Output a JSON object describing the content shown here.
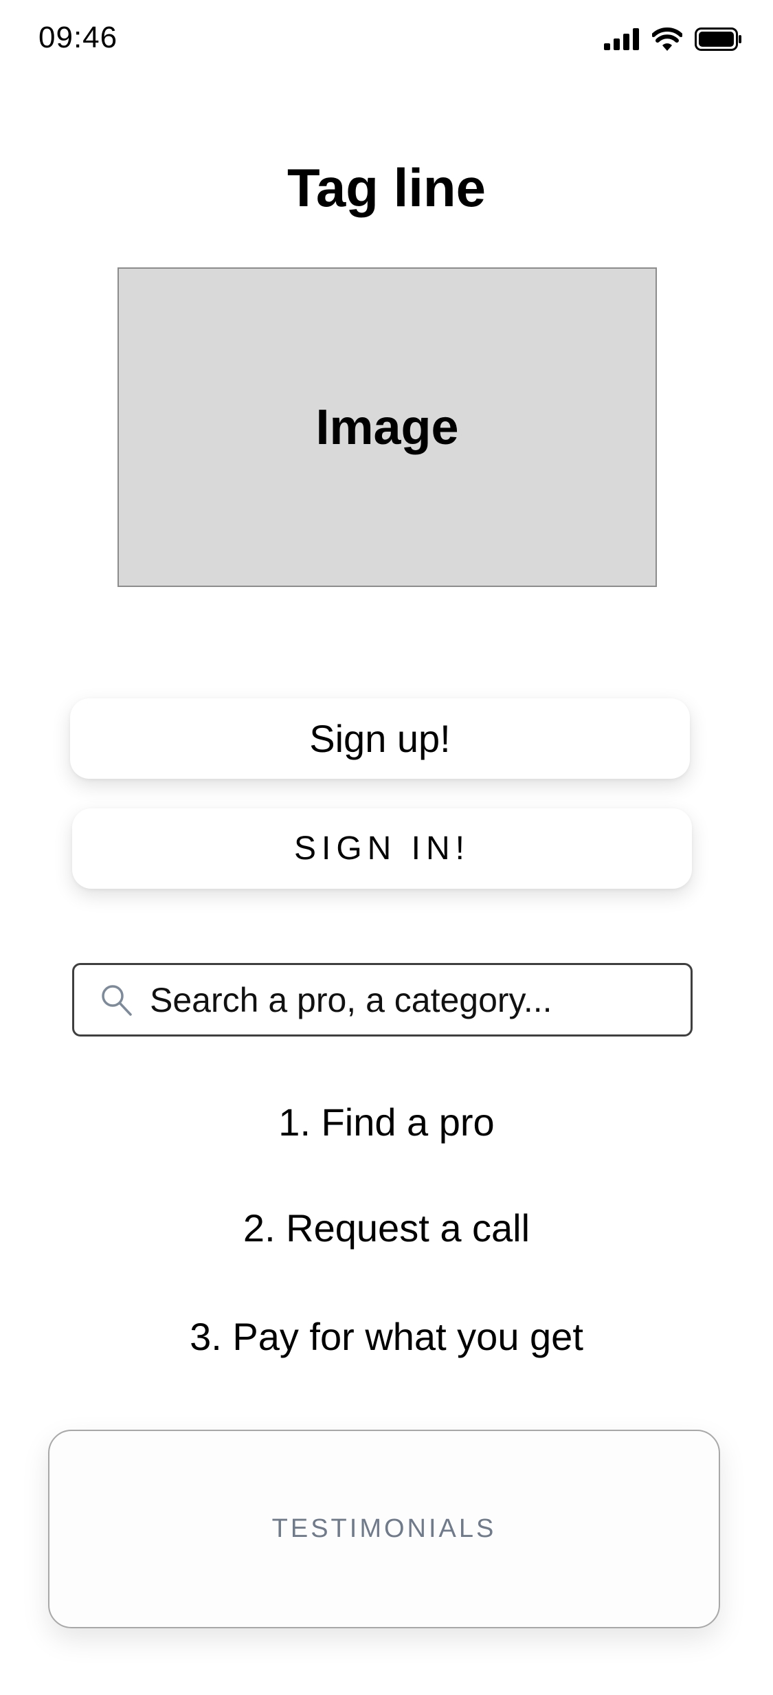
{
  "status_bar": {
    "time": "09:46"
  },
  "hero": {
    "tagline": "Tag line",
    "image_placeholder": "Image"
  },
  "actions": {
    "signup_label": "Sign up!",
    "signin_label": "SIGN IN!"
  },
  "search": {
    "placeholder": "Search a pro, a category..."
  },
  "steps": [
    {
      "label": "1. Find a pro"
    },
    {
      "label": "2. Request a call"
    },
    {
      "label": "3. Pay for what you get"
    }
  ],
  "testimonials": {
    "label": "TESTIMONIALS"
  },
  "icons": {
    "search": "search-icon",
    "signal": "cellular-signal-icon",
    "wifi": "wifi-icon",
    "battery": "battery-icon"
  },
  "colors": {
    "image_placeholder_bg": "#d9d9d9",
    "testimonials_text": "#6f7a8a"
  }
}
